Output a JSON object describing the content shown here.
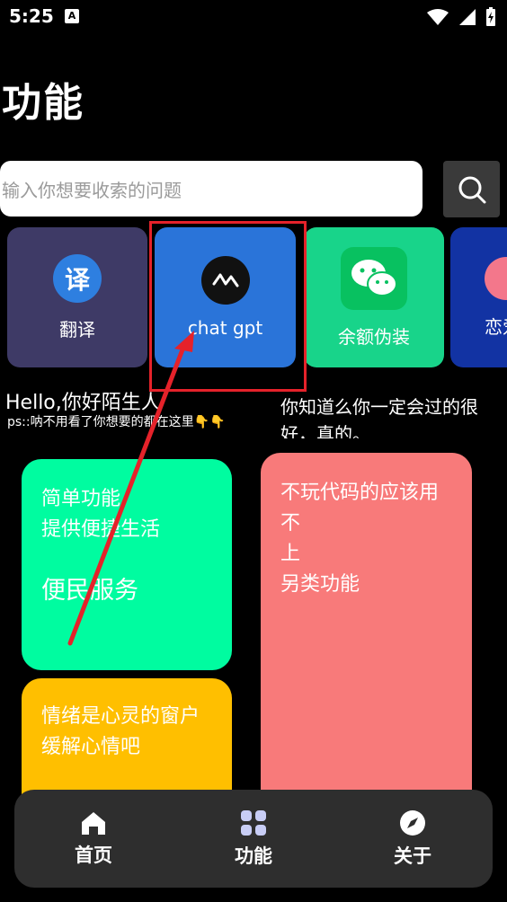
{
  "status": {
    "time": "5:25",
    "badge": "A"
  },
  "page": {
    "title": "功能"
  },
  "search": {
    "placeholder": "输入你想要收索的问题"
  },
  "cards": [
    {
      "label": "翻译",
      "icon_text": "译"
    },
    {
      "label": "chat gpt"
    },
    {
      "label": "余额伪装"
    },
    {
      "label": "恋爱"
    }
  ],
  "greeting": {
    "hello": "Hello,你好陌生人",
    "ps": "ps::呐不用看了你想要的都在这里👇👇",
    "know": "你知道么你一定会过的很好，真的。"
  },
  "tiles": {
    "simple": {
      "line1": "简单功能",
      "line2": "提供便捷生活",
      "big": "便民服务"
    },
    "pink": {
      "line1": "不玩代码的应该用不",
      "line2": "上",
      "line3": "另类功能"
    },
    "mood": {
      "line1": "情绪是心灵的窗户",
      "line2": "缓解心情吧"
    }
  },
  "nav": [
    {
      "label": "首页"
    },
    {
      "label": "功能"
    },
    {
      "label": "关于"
    }
  ],
  "colors": {
    "accent_blue": "#2a74d9",
    "highlight_red": "#e5222a",
    "green_tile": "#00fca0",
    "pink_tile": "#f87a7a",
    "yellow_tile": "#ffbf00"
  }
}
